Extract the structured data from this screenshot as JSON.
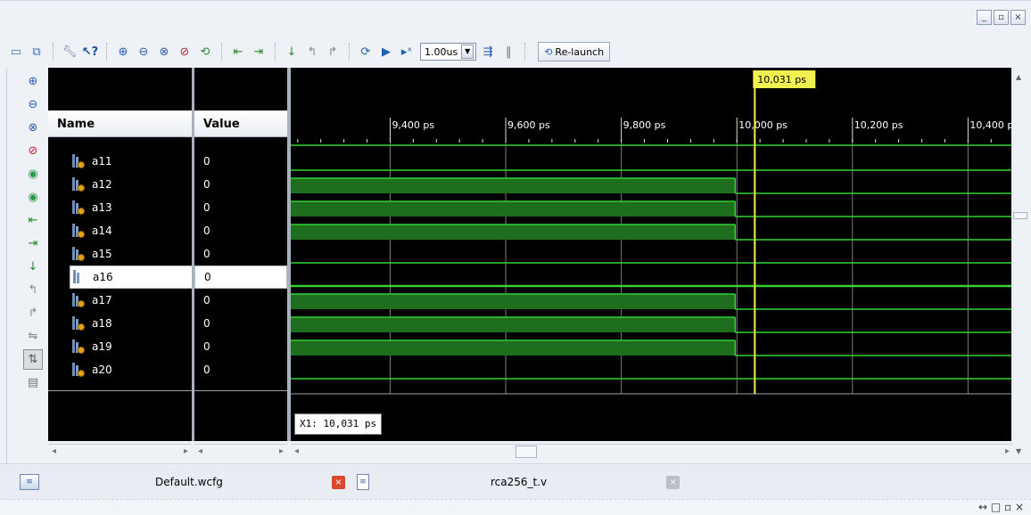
{
  "toolbar": {
    "time_step": "1.00us",
    "relaunch_label": "Re-launch"
  },
  "names_header": "Name",
  "values_header": "Value",
  "signals": [
    {
      "name": "a11",
      "value": "0"
    },
    {
      "name": "a12",
      "value": "0"
    },
    {
      "name": "a13",
      "value": "0"
    },
    {
      "name": "a14",
      "value": "0"
    },
    {
      "name": "a15",
      "value": "0"
    },
    {
      "name": "a16",
      "value": "0"
    },
    {
      "name": "a17",
      "value": "0"
    },
    {
      "name": "a18",
      "value": "0"
    },
    {
      "name": "a19",
      "value": "0"
    },
    {
      "name": "a20",
      "value": "0"
    }
  ],
  "selected_signal": "a16",
  "waveform": {
    "ticks": [
      "9,400 ps",
      "9,600 ps",
      "9,800 ps",
      "10,000 ps",
      "10,200 ps",
      "10,400 ps"
    ],
    "view_start_ps": 9228,
    "view_end_ps": 10475,
    "cursor_ps": 10031,
    "cursor_label": "10,031 ps",
    "cursor_readout": "X1: 10,031 ps",
    "transition_ps": 9997,
    "high_before_transition": [
      "a12",
      "a13",
      "a14",
      "a17",
      "a18",
      "a19"
    ],
    "wave_color": "#1f6e1f",
    "line_color": "#31d231",
    "cursor_color": "#f0f050"
  },
  "tabs": [
    {
      "label": "Default.wcfg"
    },
    {
      "label": "rca256_t.v"
    }
  ],
  "window_buttons": [
    "_",
    "▫",
    "×"
  ],
  "status_icons": "↔ □ ▫ ×"
}
